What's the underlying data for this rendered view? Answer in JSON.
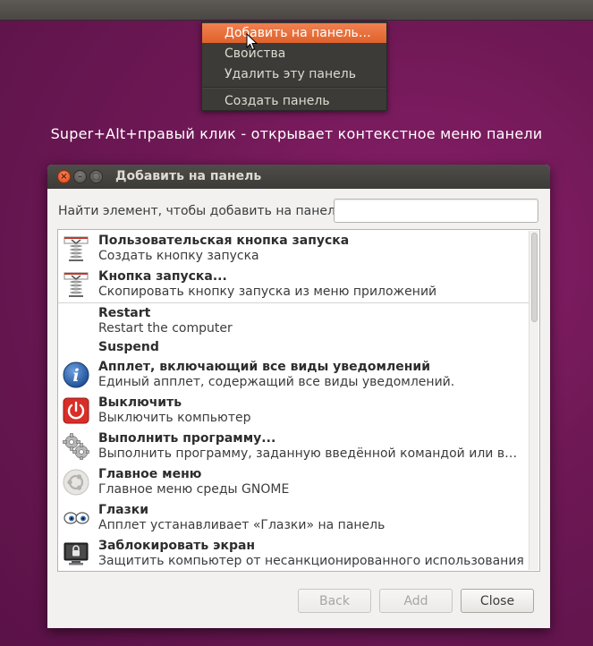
{
  "context_menu": {
    "items": [
      {
        "label": "Добавить на панель…",
        "highlighted": true
      },
      {
        "label": "Свойства",
        "highlighted": false
      },
      {
        "label": "Удалить эту панель",
        "highlighted": false
      },
      {
        "label": "Создать панель",
        "highlighted": false
      }
    ]
  },
  "caption": "Super+Alt+правый клик - открывает контекстное меню панели",
  "dialog": {
    "title": "Добавить на панель",
    "search_label": "Найти элемент, чтобы добавить на панель:",
    "search_value": "",
    "items": [
      {
        "title": "Пользовательская кнопка запуска",
        "desc": "Создать кнопку запуска",
        "icon": "launcher-icon"
      },
      {
        "title": "Кнопка запуска...",
        "desc": "Скопировать кнопку запуска из меню приложений",
        "icon": "launcher-icon"
      },
      {
        "title": "Restart",
        "desc": "Restart the computer",
        "icon": ""
      },
      {
        "title": "Suspend",
        "desc": "",
        "icon": ""
      },
      {
        "title": "Апплет, включающий все виды уведомлений",
        "desc": "Единый апплет, содержащий все виды уведомлений.",
        "icon": "info-icon"
      },
      {
        "title": "Выключить",
        "desc": "Выключить компьютер",
        "icon": "power-icon"
      },
      {
        "title": "Выполнить программу...",
        "desc": "Выполнить программу, заданную введённой командой или выбранную из списка",
        "icon": "gears-icon"
      },
      {
        "title": "Главное меню",
        "desc": "Главное меню среды GNOME",
        "icon": "ubuntu-logo-icon"
      },
      {
        "title": "Глазки",
        "desc": "Апплет устанавливает «Глазки» на панель",
        "icon": "eyes-icon"
      },
      {
        "title": "Заблокировать экран",
        "desc": "Защитить компьютер от несанкционированного использования",
        "icon": "lock-screen-icon"
      }
    ],
    "buttons": {
      "back": "Back",
      "add": "Add",
      "close": "Close"
    }
  },
  "colors": {
    "accent": "#e95420",
    "panel": "#3c3b37",
    "background": "#6e1855"
  }
}
